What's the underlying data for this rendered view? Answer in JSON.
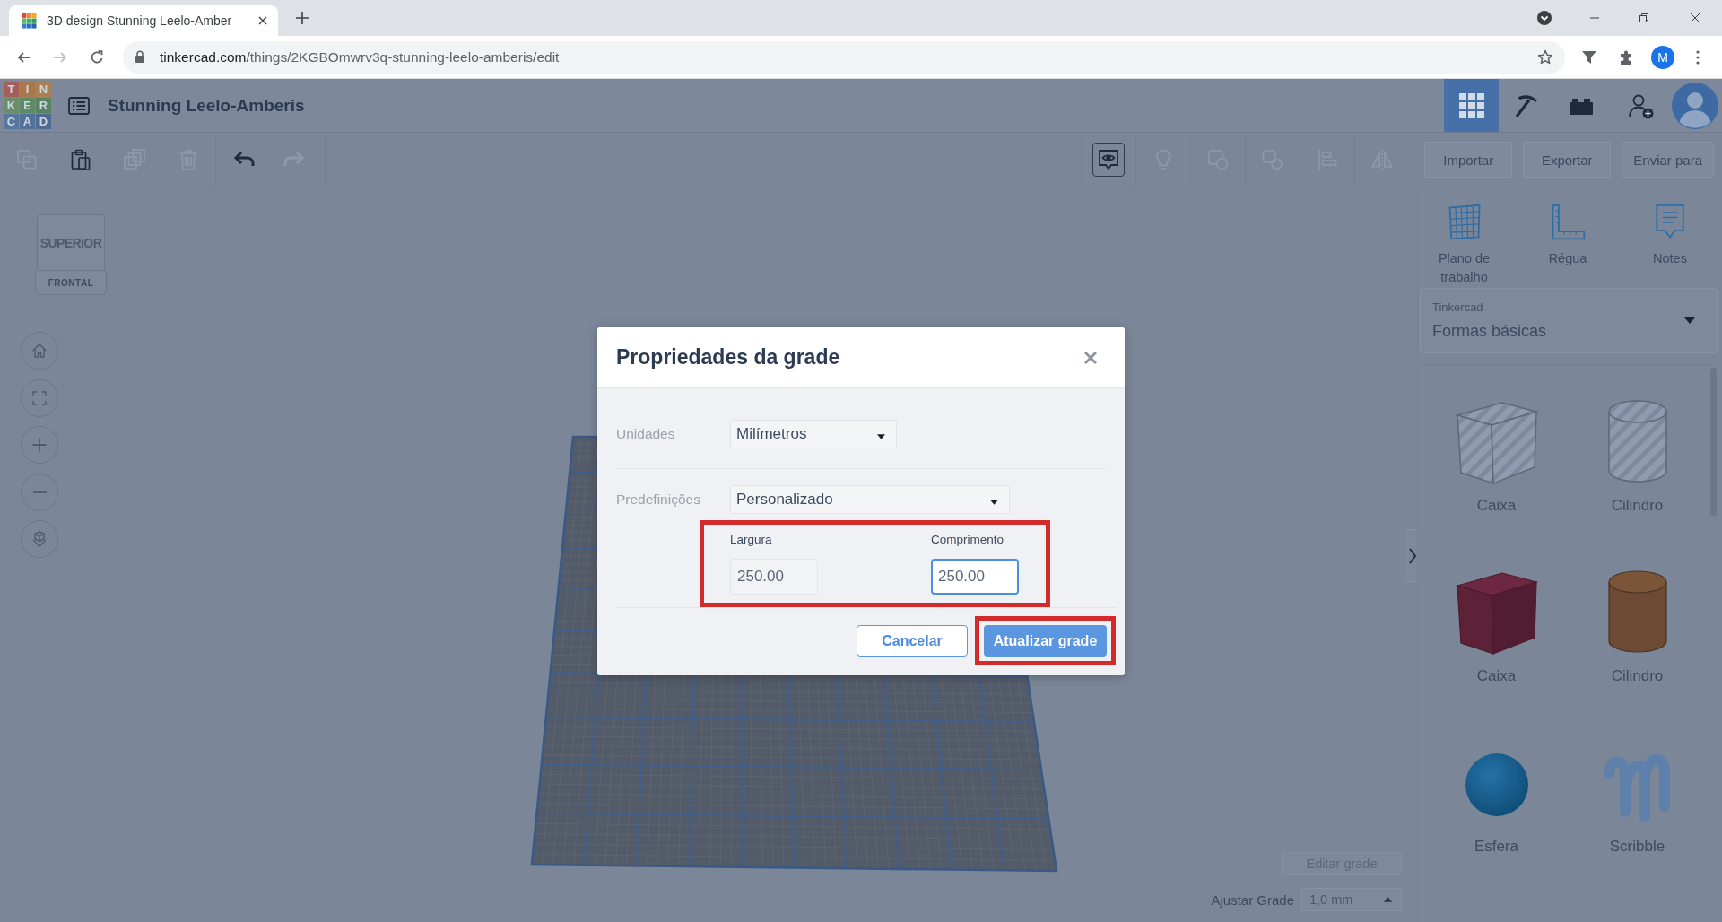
{
  "browser": {
    "tab": {
      "title": "3D design Stunning Leelo-Amber"
    },
    "url": {
      "host": "tinkercad.com",
      "path": "/things/2KGBOmwrv3q-stunning-leelo-amberis/edit"
    },
    "profile_initial": "M"
  },
  "header": {
    "logo_letters": [
      "T",
      "I",
      "N",
      "K",
      "E",
      "R",
      "C",
      "A",
      "D"
    ],
    "project_title": "Stunning Leelo-Amberis",
    "views": [
      {
        "kind": "grid",
        "selected": true
      },
      {
        "kind": "pickaxe",
        "selected": false
      },
      {
        "kind": "bricks",
        "selected": false
      }
    ]
  },
  "toolbar": {
    "edit_tools": [
      {
        "kind": "copy",
        "disabled": true
      },
      {
        "kind": "paste",
        "disabled": false
      },
      {
        "kind": "duplicate",
        "disabled": true
      },
      {
        "kind": "delete",
        "disabled": true
      },
      {
        "kind": "undo",
        "disabled": false
      },
      {
        "kind": "redo",
        "disabled": true
      }
    ],
    "view_tools": [
      {
        "kind": "notes",
        "disabled": false
      },
      {
        "kind": "bulb",
        "disabled": true
      },
      {
        "kind": "group",
        "disabled": true
      },
      {
        "kind": "hole",
        "disabled": true
      },
      {
        "kind": "align",
        "disabled": true
      },
      {
        "kind": "mirror",
        "disabled": true
      }
    ],
    "actions": [
      "Importar",
      "Exportar",
      "Enviar para"
    ]
  },
  "view_cube": {
    "top": "SUPERIOR",
    "front": "FRONTAL"
  },
  "nav_controls": [
    {
      "kind": "home"
    },
    {
      "kind": "fit"
    },
    {
      "kind": "zoom_in"
    },
    {
      "kind": "zoom_out"
    },
    {
      "kind": "projection"
    }
  ],
  "panel": {
    "tools": [
      {
        "kind": "workplane",
        "label": "Plano de trabalho"
      },
      {
        "kind": "ruler",
        "label": "Régua"
      },
      {
        "kind": "notes",
        "label": "Notes"
      }
    ],
    "library": {
      "source": "Tinkercad",
      "category": "Formas básicas"
    },
    "shapes": [
      {
        "kind": "box_hole",
        "label": "Caixa"
      },
      {
        "kind": "cylinder_hole",
        "label": "Cilindro"
      },
      {
        "kind": "box",
        "label": "Caixa"
      },
      {
        "kind": "cylinder",
        "label": "Cilindro"
      },
      {
        "kind": "sphere",
        "label": "Esfera"
      },
      {
        "kind": "scribble",
        "label": "Scribble"
      }
    ]
  },
  "grid_controls": {
    "edit_button": "Editar grade",
    "snap_label": "Ajustar Grade",
    "snap_value": "1,0 mm"
  },
  "dialog": {
    "title": "Propriedades da grade",
    "fields": [
      {
        "label": "Unidades",
        "value": "Milímetros"
      },
      {
        "label": "Predefinições",
        "value": "Personalizado"
      }
    ],
    "size": {
      "highlighted": true,
      "inputs": [
        {
          "label": "Largura",
          "value": "250.00",
          "focused": false
        },
        {
          "label": "Comprimento",
          "value": "250.00",
          "focused": true
        }
      ]
    },
    "buttons": [
      {
        "kind": "secondary",
        "label": "Cancelar",
        "highlighted": false
      },
      {
        "kind": "primary",
        "label": "Atualizar grade",
        "highlighted": true
      }
    ]
  }
}
